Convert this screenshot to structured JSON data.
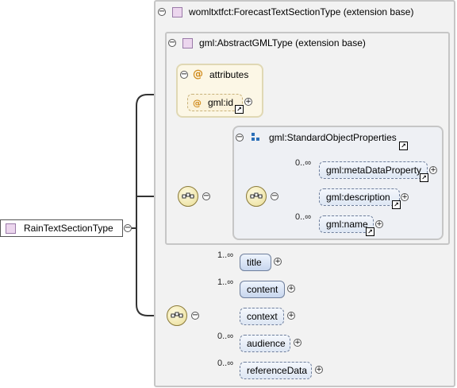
{
  "root": {
    "label": "RainTextSectionType"
  },
  "forecast_type": {
    "label": "womltxtfct:ForecastTextSectionType (extension base)"
  },
  "gml_type": {
    "label": "gml:AbstractGMLType (extension base)"
  },
  "attributes": {
    "title": "attributes",
    "id_label": "gml:id"
  },
  "standard_props": {
    "title": "gml:StandardObjectProperties",
    "items": [
      {
        "label": "gml:metaDataProperty",
        "cardinality": "0..∞"
      },
      {
        "label": "gml:description",
        "cardinality": ""
      },
      {
        "label": "gml:name",
        "cardinality": "0..∞"
      }
    ]
  },
  "sequence_items": [
    {
      "label": "title",
      "cardinality": "1..∞"
    },
    {
      "label": "content",
      "cardinality": "1..∞"
    },
    {
      "label": "context",
      "cardinality": ""
    },
    {
      "label": "audience",
      "cardinality": "0..∞"
    },
    {
      "label": "referenceData",
      "cardinality": "0..∞"
    }
  ],
  "icons": {
    "collapse": "minus-circle-icon",
    "expand": "plus-circle-icon",
    "complex_type": "complex-type-square-icon",
    "attribute": "at-sign-icon",
    "group": "group-icon",
    "sequence": "sequence-compositor-icon",
    "reference": "reference-arrow-icon"
  },
  "colors": {
    "element_fill": "#c7d6ee",
    "element_border": "#6f7f9c",
    "attribute_fill": "#fcf7e6",
    "type_square": "#ecd6ee",
    "box_border": "#c6c6c6"
  }
}
